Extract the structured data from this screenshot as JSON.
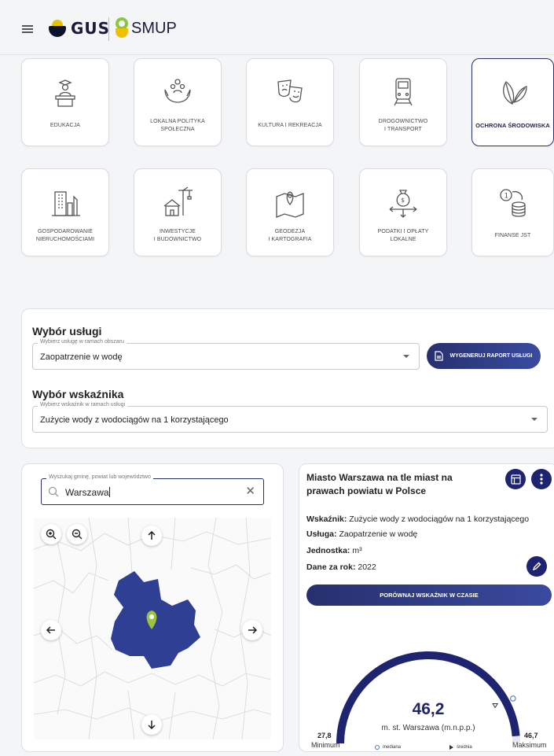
{
  "header": {
    "brand_gus": "GUS",
    "brand_smup": "SMUP"
  },
  "tiles": [
    {
      "label": "EDUKACJA",
      "icon": "teacher-podium-icon"
    },
    {
      "label": "LOKALNA POLITYKA\nSPOŁECZNA",
      "icon": "caring-hands-icon"
    },
    {
      "label": "KULTURA I REKREACJA",
      "icon": "theater-masks-icon"
    },
    {
      "label": "DROGOWNICTWO\nI TRANSPORT",
      "icon": "train-icon"
    },
    {
      "label": "OCHRONA ŚRODOWISKA",
      "icon": "leaves-icon"
    },
    {
      "label": "GOSPODAROWANIE\nNIERUCHOMOŚCIAMI",
      "icon": "buildings-icon"
    },
    {
      "label": "INWESTYCJE\nI BUDOWNICTWO",
      "icon": "construction-crane-icon"
    },
    {
      "label": "GEODEZJA\nI KARTOGRAFIA",
      "icon": "map-pin-icon"
    },
    {
      "label": "PODATKI I OPŁATY\nLOKALNE",
      "icon": "money-bag-icon"
    },
    {
      "label": "FINANSE JST",
      "icon": "coins-icon"
    }
  ],
  "service": {
    "title": "Wybór usługi",
    "field_label": "Wybierz usługę w ramach obszaru",
    "value": "Zaopatrzenie w wodę",
    "report_button": "WYGENERUJ RAPORT USŁUGI"
  },
  "indicator": {
    "title": "Wybór wskaźnika",
    "field_label": "Wybierz wskaźnik w ramach usługi",
    "value": "Zużycie wody z wodociągów na 1 korzystającego"
  },
  "search": {
    "label": "Wyszukaj gminę, powiat lub województwo",
    "value": "Warszawa"
  },
  "result": {
    "title": "Miasto Warszawa na tle miast na prawach powiatu w Polsce",
    "indicator_label": "Wskaźnik:",
    "indicator_value": "Zużycie wody z wodociągów na 1 korzystającego",
    "service_label": "Usługa:",
    "service_value": "Zaopatrzenie w wodę",
    "unit_label": "Jednostka:",
    "unit_value": "m³",
    "year_label": "Dane za rok:",
    "year_value": "2022",
    "compare_button": "PORÓWNAJ WSKAŹNIK W CZASIE"
  },
  "gauge": {
    "value_text": "46,2",
    "value": 46.2,
    "min": 27.8,
    "max": 46.7,
    "min_text": "27,8",
    "max_text": "46,7",
    "min_caption": "Minimum",
    "max_caption": "Maksimum",
    "subject": "m. st. Warszawa (m.n.p.p.)",
    "legend_median": "mediana",
    "legend_mean": "średnia"
  },
  "colors": {
    "navy": "#1e2470",
    "map_fill": "#2f3f93",
    "pin": "#9ac43c"
  }
}
